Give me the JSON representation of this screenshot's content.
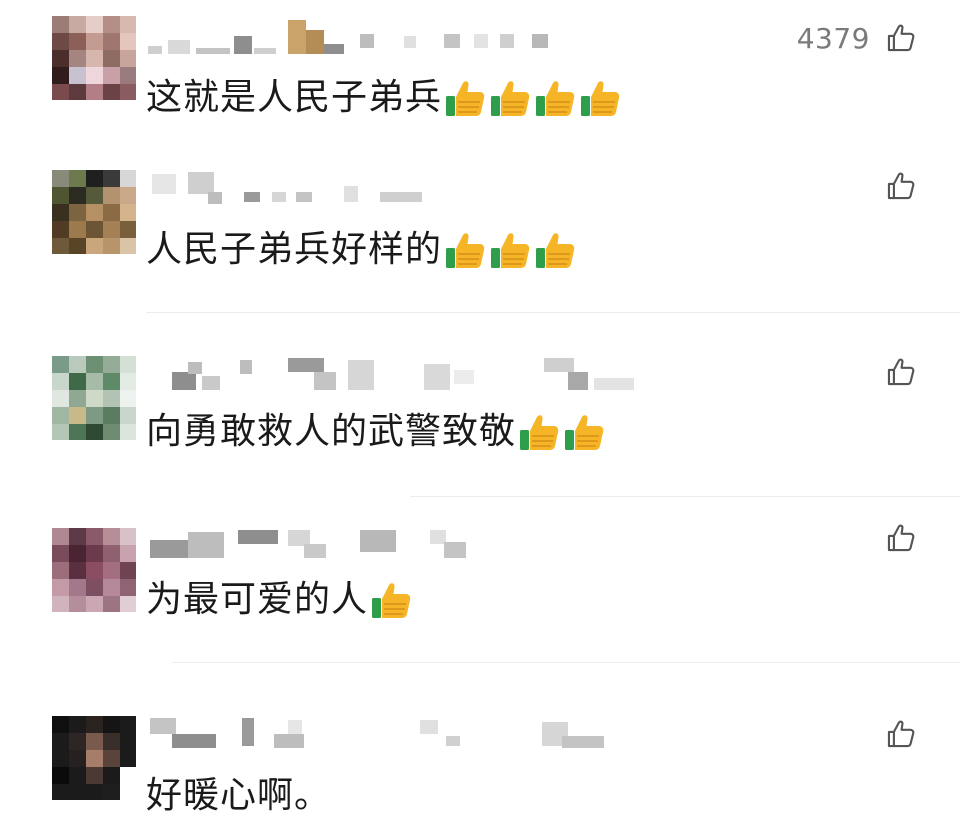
{
  "comments": [
    {
      "username": "",
      "text": "这就是人民子弟兵",
      "like_count": "4379",
      "emoji_count": 4
    },
    {
      "username": "",
      "text": "人民子弟兵好样的",
      "like_count": "",
      "emoji_count": 3
    },
    {
      "username": "",
      "text": "向勇敢救人的武警致敬",
      "like_count": "",
      "emoji_count": 2
    },
    {
      "username": "",
      "text": "为最可爱的人",
      "like_count": "",
      "emoji_count": 1
    },
    {
      "username": "",
      "text": "好暖心啊。",
      "like_count": "",
      "emoji_count": 0
    }
  ],
  "icons": {
    "like": "thumbs-up-outline-icon",
    "emoji": "thumbs-up-emoji-icon"
  },
  "colors": {
    "text": "#1a1a1a",
    "meta": "#7a7a7a",
    "divider": "#ececec",
    "emoji_hand": "#f5b526",
    "emoji_cuff": "#2e9e4a"
  }
}
